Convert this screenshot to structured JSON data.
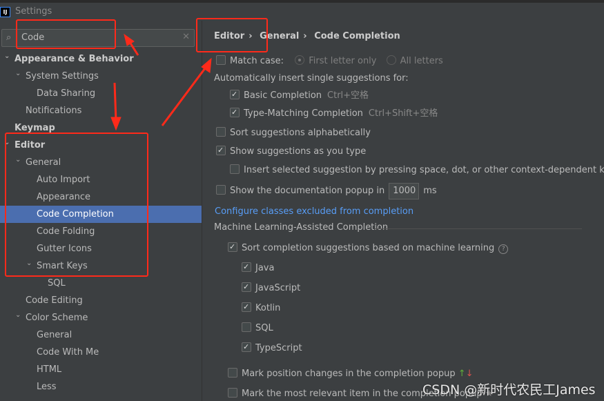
{
  "window": {
    "title": "Settings",
    "logo": "IJ"
  },
  "search": {
    "value": "Code",
    "icon": "search-icon",
    "clear_icon": "close-icon"
  },
  "tree": [
    {
      "label": "Appearance & Behavior",
      "level": 0,
      "expanded": true,
      "bold": true
    },
    {
      "label": "System Settings",
      "level": 1,
      "expanded": true
    },
    {
      "label": "Data Sharing",
      "level": 2
    },
    {
      "label": "Notifications",
      "level": 1
    },
    {
      "label": "Keymap",
      "level": 0,
      "bold": true
    },
    {
      "label": "Editor",
      "level": 0,
      "expanded": true,
      "bold": true
    },
    {
      "label": "General",
      "level": 1,
      "expanded": true
    },
    {
      "label": "Auto Import",
      "level": 2
    },
    {
      "label": "Appearance",
      "level": 2
    },
    {
      "label": "Code Completion",
      "level": 2,
      "selected": true
    },
    {
      "label": "Code Folding",
      "level": 2
    },
    {
      "label": "Gutter Icons",
      "level": 2
    },
    {
      "label": "Smart Keys",
      "level": 2,
      "expanded": true
    },
    {
      "label": "SQL",
      "level": 3
    },
    {
      "label": "Code Editing",
      "level": 1
    },
    {
      "label": "Color Scheme",
      "level": 1,
      "expanded": true
    },
    {
      "label": "General",
      "level": 2
    },
    {
      "label": "Code With Me",
      "level": 2
    },
    {
      "label": "HTML",
      "level": 2
    },
    {
      "label": "Less",
      "level": 2
    }
  ],
  "breadcrumb": [
    "Editor",
    "General",
    "Code Completion"
  ],
  "options": {
    "match_case": "Match case:",
    "first_letter": "First letter only",
    "all_letters": "All letters",
    "auto_insert": "Automatically insert single suggestions for:",
    "basic": "Basic Completion",
    "basic_shortcut": "Ctrl+空格",
    "type_matching": "Type-Matching Completion",
    "type_shortcut": "Ctrl+Shift+空格",
    "sort_alpha": "Sort suggestions alphabetically",
    "show_as_type": "Show suggestions as you type",
    "insert_selected": "Insert selected suggestion by pressing space, dot, or other context-dependent keys",
    "doc_popup": "Show the documentation popup in",
    "doc_delay": "1000",
    "doc_unit": "ms",
    "configure_link": "Configure classes excluded from completion",
    "ml_section": "Machine Learning-Assisted Completion",
    "ml_sort": "Sort completion suggestions based on machine learning",
    "languages": [
      {
        "label": "Java",
        "checked": true
      },
      {
        "label": "JavaScript",
        "checked": true
      },
      {
        "label": "Kotlin",
        "checked": true
      },
      {
        "label": "SQL",
        "checked": false
      },
      {
        "label": "TypeScript",
        "checked": true
      }
    ],
    "mark_position": "Mark position changes in the completion popup",
    "mark_relevant": "Mark the most relevant item in the completion popup"
  },
  "watermark": "CSDN @新时代农民工James",
  "colors": {
    "selection": "#4b6eaf",
    "annotation": "#ff2a1a",
    "link": "#589df6"
  }
}
